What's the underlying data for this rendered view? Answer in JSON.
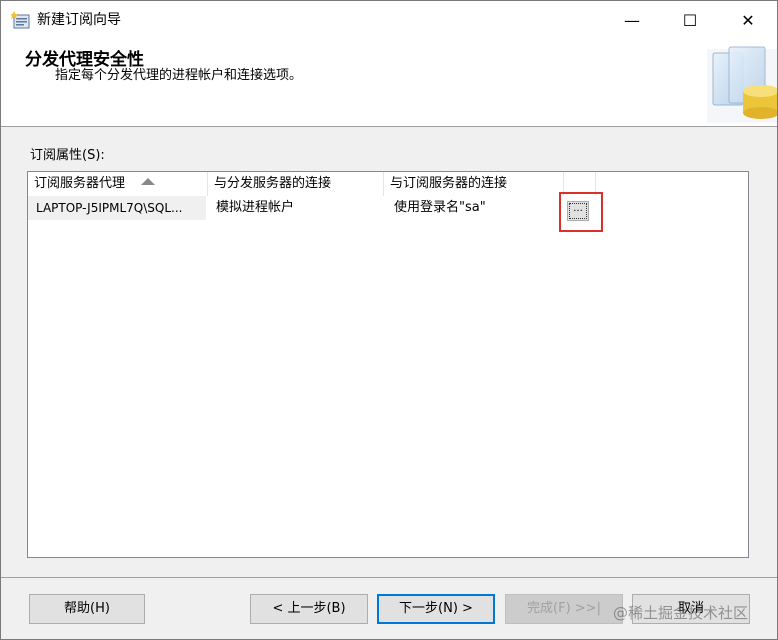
{
  "window": {
    "title": "新建订阅向导",
    "minimize_glyph": "—",
    "maximize_glyph": "☐",
    "close_glyph": "✕"
  },
  "header": {
    "title": "分发代理安全性",
    "description": "指定每个分发代理的进程帐户和连接选项。"
  },
  "properties": {
    "label": "订阅属性(S):",
    "columns": [
      "订阅服务器代理",
      "与分发服务器的连接",
      "与订阅服务器的连接"
    ],
    "rows": [
      {
        "agent": "LAPTOP-J5IPML7Q\\SQL...",
        "distributor_connection": "模拟进程帐户",
        "subscriber_connection": "使用登录名\"sa\"",
        "browse_label": "..."
      }
    ]
  },
  "footer": {
    "help": "帮助(H)",
    "prev": "< 上一步(B)",
    "next": "下一步(N) >",
    "finish": "完成(F) >>|",
    "cancel": "取消",
    "watermark": "@稀土掘金技术社区"
  },
  "colors": {
    "highlight": "#d9302c",
    "default_button_border": "#0078d7"
  }
}
